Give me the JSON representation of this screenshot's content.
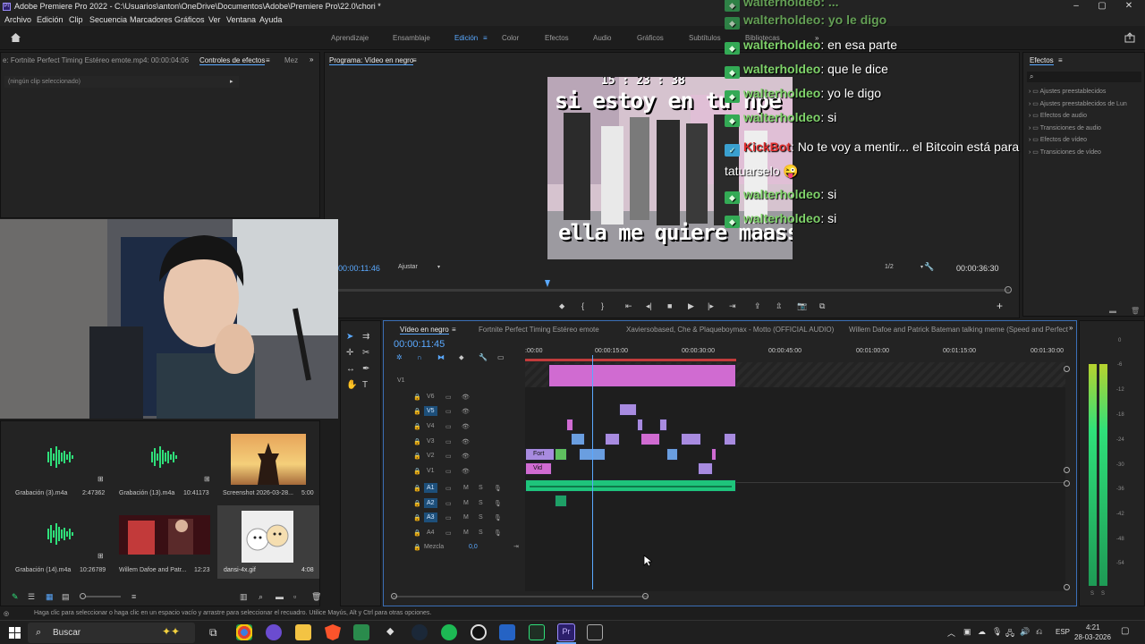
{
  "window": {
    "title": "Adobe Premiere Pro 2022 - C:\\Usuarios\\anton\\OneDrive\\Documentos\\Adobe\\Premiere Pro\\22.0\\chori *",
    "app_badge": "Pr"
  },
  "menu": [
    "Archivo",
    "Edición",
    "Clip",
    "Secuencia",
    "Marcadores",
    "Gráficos",
    "Ver",
    "Ventana",
    "Ayuda"
  ],
  "workspaces": {
    "items": [
      "Aprendizaje",
      "Ensamblaje",
      "Edición",
      "Color",
      "Efectos",
      "Audio",
      "Gráficos",
      "Subtítulos",
      "Bibliotecas"
    ],
    "active": "Edición",
    "more": "»"
  },
  "source_panel": {
    "tab1": "e: Fortnite Perfect Timing Estéreo emote.mp4: 00:00:04:06",
    "tab2": "Controles de efectos",
    "tab3": "Mez",
    "no_clip": "(ningún clip seleccionado)"
  },
  "program_monitor": {
    "title": "Programa: Vídeo en negro",
    "timecode_left": "00:00:11:46",
    "fit": "Ajustar",
    "quality": "1/2",
    "timecode_right": "00:00:36:30",
    "overlay_time": "15 : 23 : 38",
    "caption_top": "si estoy en tu hpe",
    "caption_bottom": "ella me quiere maass"
  },
  "chat": [
    {
      "user": "walterholdeo",
      "msg": "en esa parte"
    },
    {
      "user": "walterholdeo",
      "msg": "que le dice"
    },
    {
      "user": "walterholdeo",
      "msg": "yo le digo"
    },
    {
      "user": "walterholdeo",
      "msg": "si"
    },
    {
      "user": "KickBot",
      "msg": "No te voy a mentir... el Bitcoin está para tatuarselo"
    },
    {
      "user": "walterholdeo",
      "msg": "si"
    },
    {
      "user": "walterholdeo",
      "msg": "si"
    }
  ],
  "chat_top_partial": [
    "walterholdeo: ...",
    "walterholdeo: yo le digo"
  ],
  "effects_panel": {
    "title": "Efectos",
    "items": [
      "Ajustes preestablecidos",
      "Ajustes preestablecidos de Lun",
      "Efectos de audio",
      "Transiciones de audio",
      "Efectos de vídeo",
      "Transiciones de vídeo"
    ]
  },
  "timeline": {
    "tabs": [
      "Vídeo en negro",
      "Fortnite Perfect Timing Estéreo emote",
      "Xaviersobased, Che & Plaqueboymax - Motto (OFFICIAL AUDIO)",
      "Willem Dafoe and Patrick Bateman talking meme (Speed and Perfect"
    ],
    "timecode": "00:00:11:45",
    "ruler": [
      ":00:00",
      "00:00:15:00",
      "00:00:30:00",
      "00:00:45:00",
      "00:01:00:00",
      "00:01:15:00",
      "00:01:30:00"
    ],
    "video_tracks": [
      "V6",
      "V5",
      "V4",
      "V3",
      "V2",
      "V1"
    ],
    "audio_tracks": [
      "A1",
      "A2",
      "A3",
      "A4"
    ],
    "mix_label": "Mezcla",
    "mix_value": "0,0",
    "clip_labels": {
      "v2": "Fort",
      "v1": "Vid"
    },
    "v1_side": "V1"
  },
  "project_bin": [
    {
      "name": "Grabación (3).m4a",
      "dur": "2:47362"
    },
    {
      "name": "Grabación (13).m4a",
      "dur": "10:41173"
    },
    {
      "name": "Screenshot 2026-03-28...",
      "dur": "5:00"
    },
    {
      "name": "Grabación (14).m4a",
      "dur": "10:26789"
    },
    {
      "name": "Willem Dafoe and Patr...",
      "dur": "12:23"
    },
    {
      "name": "dansi-4x.gif",
      "dur": "4:08"
    }
  ],
  "status_bar": "Haga clic para seleccionar o haga clic en un espacio vacío y arrastre para seleccionar el recuadro. Utilice Mayús, Alt y Ctrl para otras opciones.",
  "meter_scale": [
    "0",
    "-6",
    "-12",
    "-18",
    "-24",
    "-30",
    "-36",
    "-42",
    "-48",
    "-54"
  ],
  "meter_solo": [
    "S",
    "S"
  ],
  "taskbar": {
    "search": "Buscar",
    "lang": "ESP",
    "time": "4:21",
    "date": "28-03-2026"
  },
  "colors": {
    "accent": "#5aa9ff",
    "clip_pink": "#d06bd1",
    "clip_purple": "#a88be0",
    "clip_blue": "#6a9ee0",
    "audio_green": "#1ec47b",
    "chat_user": "#7fd36a"
  }
}
